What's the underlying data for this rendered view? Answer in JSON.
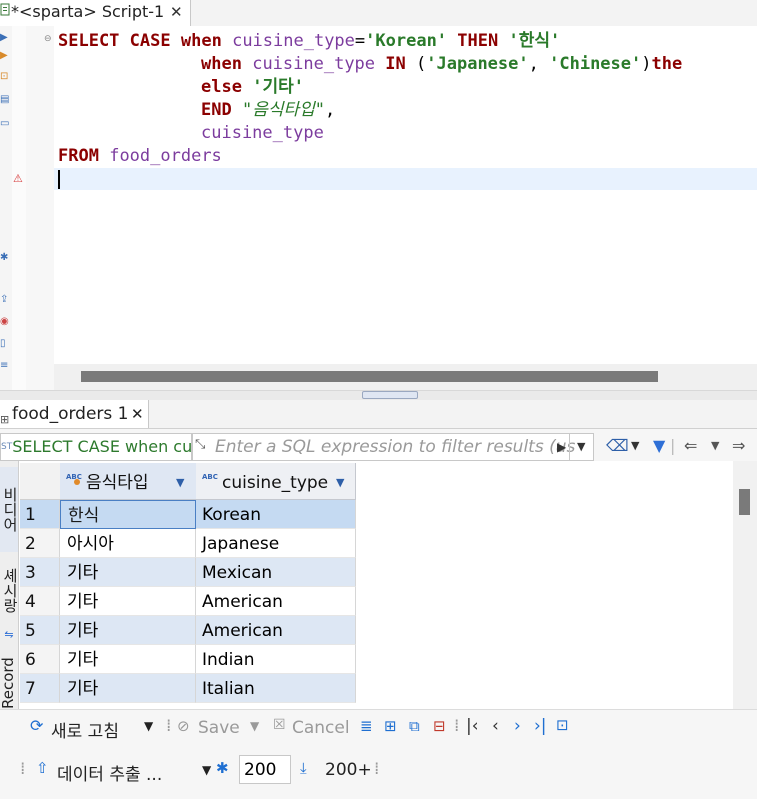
{
  "editor_tab": {
    "title": "*<sparta> Script-1",
    "close": "✕"
  },
  "sql": {
    "line1": {
      "kw_select": "SELECT",
      "kw_case": "CASE",
      "kw_when": "when",
      "col": "cuisine_type",
      "op": "=",
      "str": "'Korean'",
      "kw_then": "THEN",
      "str2": "'한식'"
    },
    "line2": {
      "kw_when": "when",
      "col": "cuisine_type",
      "kw_in": "IN",
      "open": "(",
      "str1": "'Japanese'",
      "comma": ",",
      "str2": "'Chinese'",
      "close": ")",
      "kw_then": "the"
    },
    "line3": {
      "kw_else": "else",
      "str": "'기타'"
    },
    "line4": {
      "kw_end": "END",
      "alias": "\"음식타입\"",
      "comma": ","
    },
    "line5": {
      "col": "cuisine_type"
    },
    "line6": {
      "kw_from": "FROM",
      "table": "food_orders"
    }
  },
  "results_tab": {
    "title": "food_orders 1",
    "close": "✕"
  },
  "filter": {
    "query_text": "SELECT CASE when cuisine_",
    "placeholder": "Enter a SQL expression to filter results (us"
  },
  "side_tabs": {
    "grid": "비디어",
    "text": "셰시랑",
    "record": "Record"
  },
  "grid": {
    "columns": [
      {
        "label": "음식타입",
        "type_badge": "ABC"
      },
      {
        "label": "cuisine_type",
        "type_badge": "ABC"
      }
    ],
    "rows": [
      {
        "num": "1",
        "food_type": "한식",
        "cuisine": "Korean"
      },
      {
        "num": "2",
        "food_type": "아시아",
        "cuisine": "Japanese"
      },
      {
        "num": "3",
        "food_type": "기타",
        "cuisine": "Mexican"
      },
      {
        "num": "4",
        "food_type": "기타",
        "cuisine": "American"
      },
      {
        "num": "5",
        "food_type": "기타",
        "cuisine": "American"
      },
      {
        "num": "6",
        "food_type": "기타",
        "cuisine": "Indian"
      },
      {
        "num": "7",
        "food_type": "기타",
        "cuisine": "Italian"
      }
    ]
  },
  "toolbar": {
    "refresh_label": "새로 고침",
    "save_label": "Save",
    "cancel_label": "Cancel",
    "export_label": "데이터 추출 ...",
    "fetch_size": "200",
    "fetch_all_label": "200+"
  },
  "colors": {
    "keyword": "#8b0000",
    "identifier": "#7c3c9e",
    "string": "#2a7a2a",
    "selection": "#c5daf2",
    "accent": "#1f6fd1"
  }
}
